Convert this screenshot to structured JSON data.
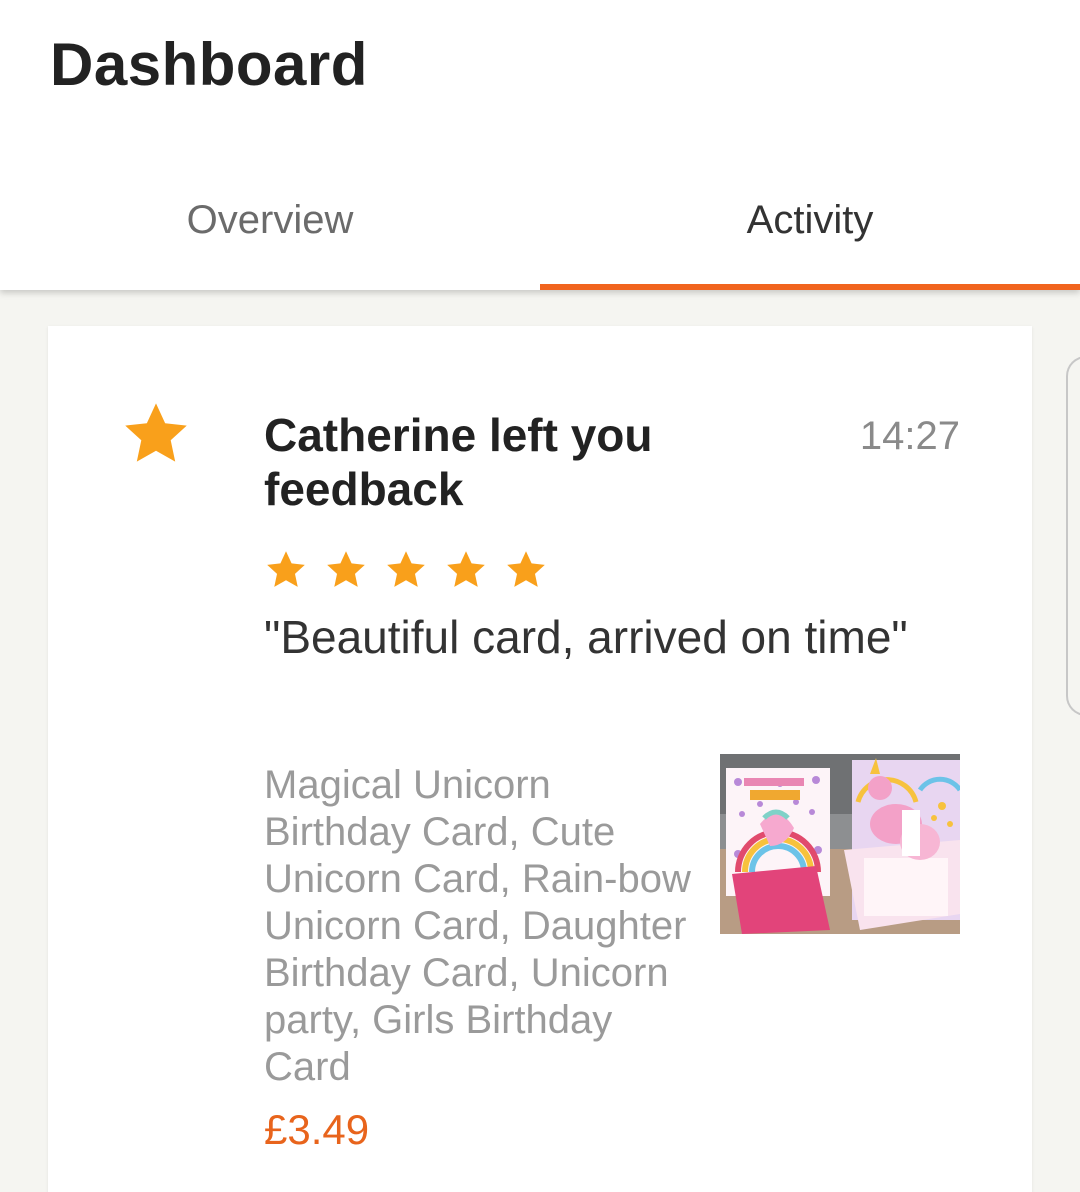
{
  "header": {
    "title": "Dashboard"
  },
  "tabs": [
    {
      "label": "Overview",
      "active": false
    },
    {
      "label": "Activity",
      "active": true
    }
  ],
  "activity": {
    "icon": "star-icon",
    "title": "Catherine left you feedback",
    "time": "14:27",
    "rating": 5,
    "rating_max": 5,
    "review": "\"Beautiful card, arrived on time\"",
    "listing": {
      "title": "Magical Unicorn Birthday Card, Cute Unicorn Card, Rain-bow Unicorn Card, Daughter Birthday Card, Unicorn party, Girls Birthday Card",
      "price": "£3.49",
      "image_icon": "product-image"
    }
  },
  "colors": {
    "accent": "#f1641e",
    "star": "#f9a01b",
    "price": "#e8641c",
    "background": "#f5f5f1"
  }
}
